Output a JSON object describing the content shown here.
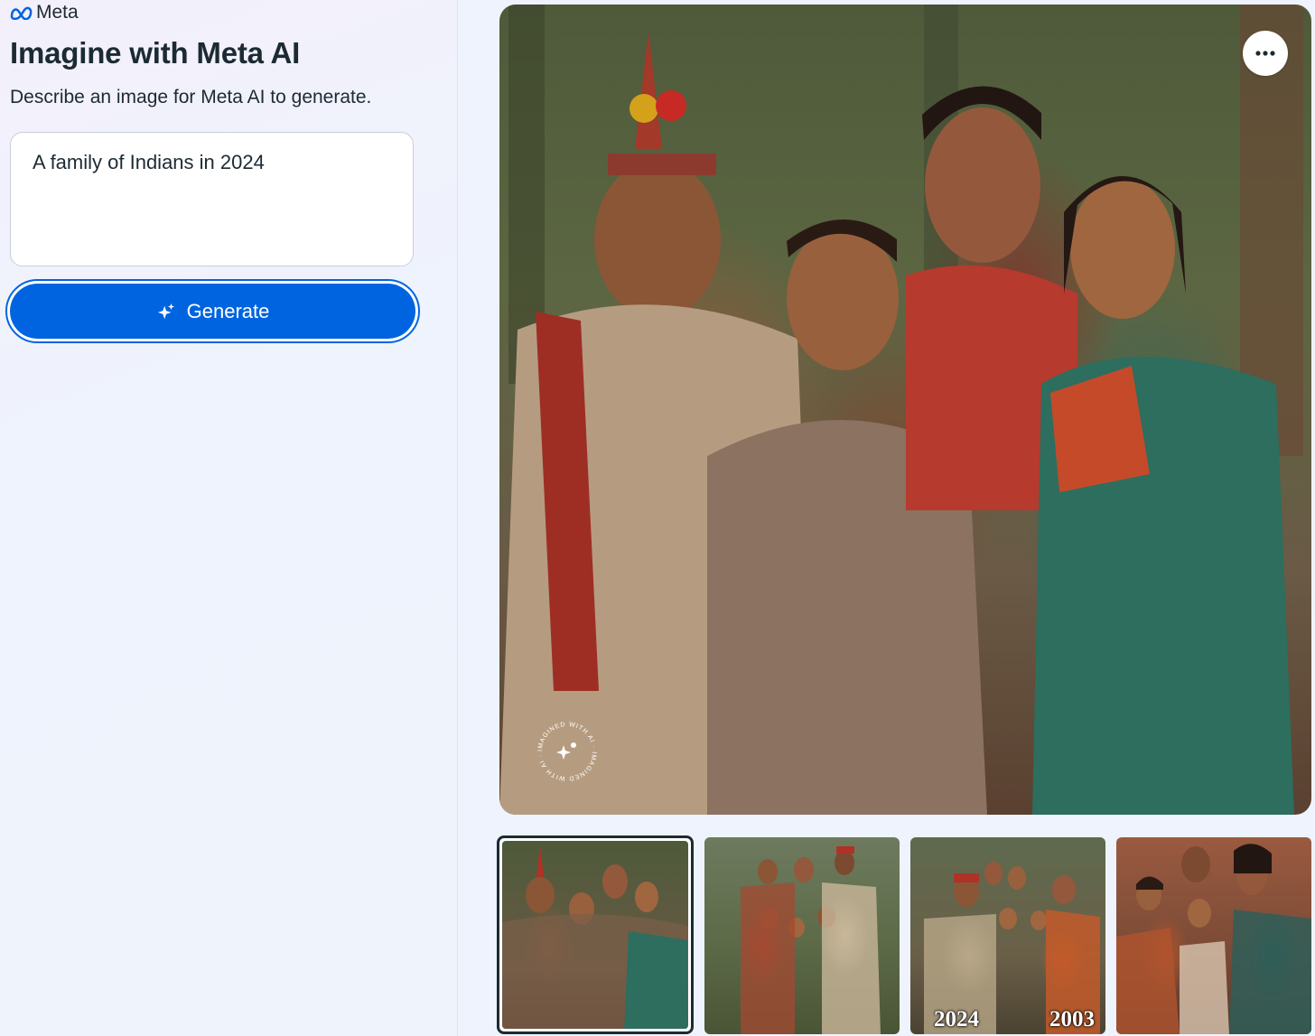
{
  "app": {
    "brand_name": "Meta"
  },
  "sidebar": {
    "title": "Imagine with Meta AI",
    "subtitle": "Describe an image for Meta AI to generate.",
    "prompt": {
      "value": "A family of Indians in 2024"
    },
    "generate_button": {
      "label": "Generate",
      "icon": "sparkle-icon",
      "color": "#0064e0"
    }
  },
  "main_image": {
    "more_button_icon": "more-options-icon",
    "watermark_text": "IMAGINED WITH AI · IMAGINED WITH AI ·"
  },
  "thumbnails": [
    {
      "selected": true,
      "overlay_left": "",
      "overlay_right": ""
    },
    {
      "selected": false,
      "overlay_left": "",
      "overlay_right": ""
    },
    {
      "selected": false,
      "overlay_left": "2024",
      "overlay_right": "2003"
    },
    {
      "selected": false,
      "overlay_left": "",
      "overlay_right": ""
    }
  ],
  "colors": {
    "accent": "#0064e0",
    "text": "#1c2b33",
    "background": "#eef3fd"
  }
}
